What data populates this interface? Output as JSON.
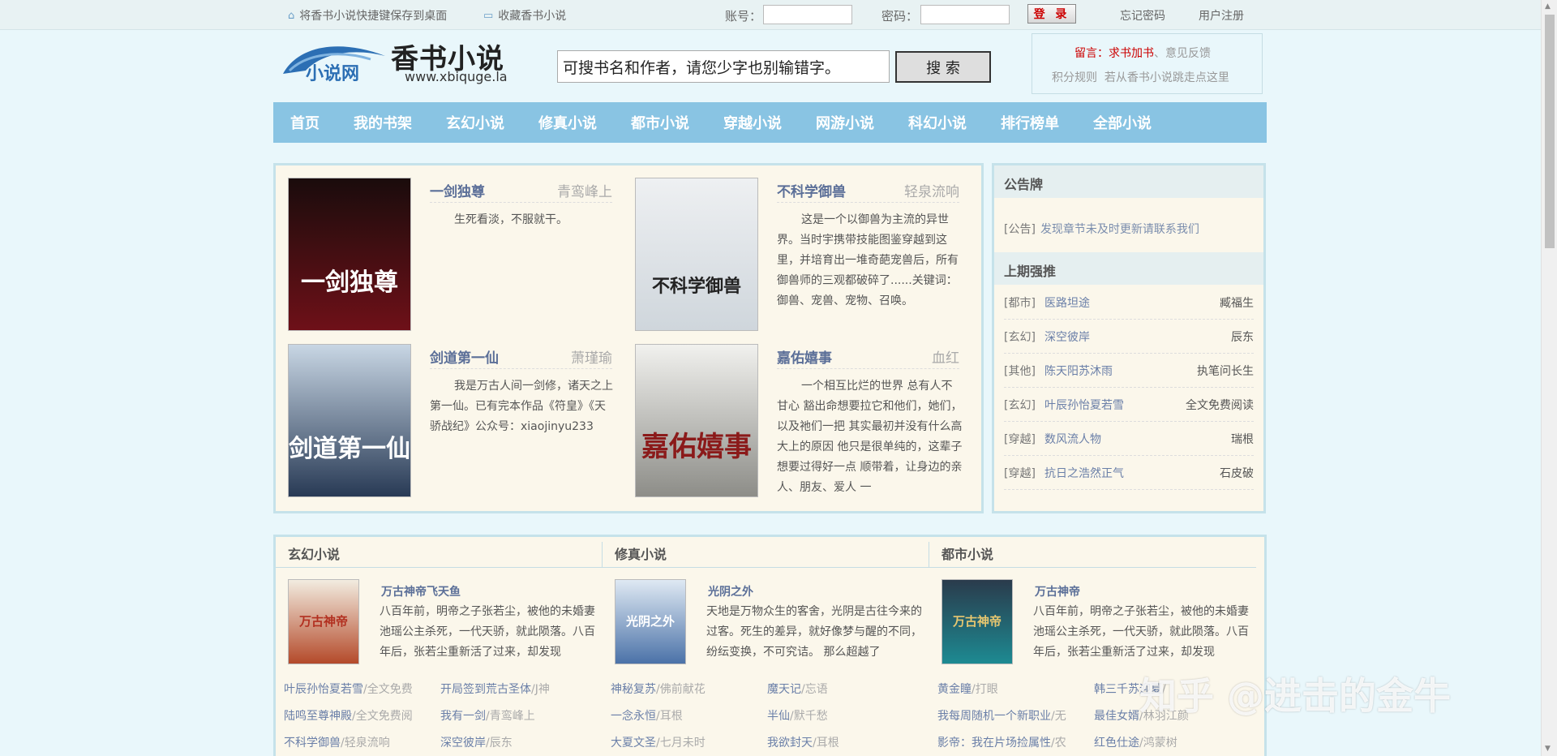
{
  "topbar": {
    "bookmark_desktop": "将香书小说快捷键保存到桌面",
    "favorite": "收藏香书小说",
    "account_label": "账号：",
    "password_label": "密码：",
    "login_label": "登 录",
    "forgot_password": "忘记密码",
    "register": "用户注册"
  },
  "header": {
    "logo_tagline": "小说网",
    "logo_brand": "香书小说",
    "logo_url": "www.xbiquge.la",
    "search_value": "可搜书名和作者，请您少字也别输错字。",
    "search_button": "搜 索",
    "note_prefix": "留言：",
    "note_add_book": "求书加书",
    "note_sep": "、",
    "note_feedback": "意见反馈",
    "note_rules": "积分规则",
    "note_slow": "若从香书小说跳走点这里"
  },
  "nav": [
    "首页",
    "我的书架",
    "玄幻小说",
    "修真小说",
    "都市小说",
    "穿越小说",
    "网游小说",
    "科幻小说",
    "排行榜单",
    "全部小说"
  ],
  "hot_books": [
    {
      "title": "一剑独尊",
      "author": "青鸾峰上",
      "desc": "生死看淡，不服就干。",
      "cover_text": "一剑独尊",
      "cover_colors": [
        "#1a0c0c",
        "#6e1018"
      ]
    },
    {
      "title": "不科学御兽",
      "author": "轻泉流响",
      "desc": "这是一个以御兽为主流的异世界。当时宇携带技能图鉴穿越到这里，并培育出一堆奇葩宠兽后，所有御兽师的三观都破碎了......关键词：御兽、宠兽、宠物、召唤。",
      "cover_text": "不科学御兽",
      "cover_colors": [
        "#eef0f2",
        "#cfd6dc"
      ]
    },
    {
      "title": "剑道第一仙",
      "author": "萧瑾瑜",
      "desc": "我是万古人间一剑修，诸天之上第一仙。已有完本作品《符皇》《天骄战纪》公众号：xiaojinyu233",
      "cover_text": "剑道第一仙",
      "cover_colors": [
        "#c8d6e4",
        "#283a55"
      ]
    },
    {
      "title": "嘉佑嬉事",
      "author": "血红",
      "desc": "一个相互比烂的世界 总有人不甘心 豁出命想要拉它和他们，她们，以及祂们一把 其实最初并没有什么高大上的原因 他只是很单纯的，这辈子想要过得好一点 顺带着，让身边的亲人、朋友、爱人 一",
      "cover_text": "嘉佑嬉事",
      "cover_colors": [
        "#f1f1ee",
        "#8d8d88"
      ]
    }
  ],
  "notice": {
    "head": "公告牌",
    "tag": "[公告]",
    "text": "发现章节未及时更新请联系我们",
    "rec_head": "上期强推",
    "recs": [
      {
        "cat": "[都市]",
        "title": "医路坦途",
        "author": "臧福生"
      },
      {
        "cat": "[玄幻]",
        "title": "深空彼岸",
        "author": "辰东"
      },
      {
        "cat": "[其他]",
        "title": "陈天阳苏沐雨",
        "author": "执笔问长生"
      },
      {
        "cat": "[玄幻]",
        "title": "叶辰孙怡夏若雪",
        "author": "全文免费阅读"
      },
      {
        "cat": "[穿越]",
        "title": "数风流人物",
        "author": "瑞根"
      },
      {
        "cat": "[穿越]",
        "title": "抗日之浩然正气",
        "author": "石皮破"
      }
    ]
  },
  "categories": [
    {
      "head": "玄幻小说",
      "featured_title": "万古神帝飞天鱼",
      "featured_desc": "八百年前，明帝之子张若尘，被他的未婚妻池瑶公主杀死，一代天骄，就此陨落。八百年后，张若尘重新活了过来，却发现",
      "thumb_text": "万古神帝",
      "thumb_colors": [
        "#f2ece0",
        "#b44a2a"
      ],
      "links": [
        [
          "叶辰孙怡夏若雪",
          "/全文免费",
          "开局签到荒古圣体",
          "/J神"
        ],
        [
          "陆鸣至尊神殿",
          "/全文免费阅",
          "我有一剑",
          "/青鸾峰上"
        ],
        [
          "不科学御兽",
          "/轻泉流响",
          "深空彼岸",
          "/辰东"
        ]
      ]
    },
    {
      "head": "修真小说",
      "featured_title": "光阴之外",
      "featured_desc": "天地是万物众生的客舍，光阴是古往今来的过客。死生的差异，就好像梦与醒的不同，纷纭变换，不可究诘。 那么超越了",
      "thumb_text": "光阴之外",
      "thumb_colors": [
        "#dfe9f3",
        "#4b72a8"
      ],
      "links": [
        [
          "神秘复苏",
          "/佛前献花",
          "魔天记",
          "/忘语"
        ],
        [
          "一念永恒",
          "/耳根",
          "半仙",
          "/默千愁"
        ],
        [
          "大夏文圣",
          "/七月未时",
          "我欲封天",
          "/耳根"
        ]
      ]
    },
    {
      "head": "都市小说",
      "featured_title": "万古神帝",
      "featured_desc": "八百年前，明帝之子张若尘，被他的未婚妻池瑶公主杀死，一代天骄，就此陨落。八百年后，张若尘重新活了过来，却发现",
      "thumb_text": "万古神帝",
      "thumb_colors": [
        "#2a3b4c",
        "#1d8a92"
      ],
      "links": [
        [
          "黄金瞳",
          "/打眼",
          "韩三千苏迎夏",
          "/"
        ],
        [
          "我每周随机一个新职业",
          "/无",
          "最佳女婿",
          "/林羽江颜"
        ],
        [
          "影帝：我在片场捡属性",
          "/农",
          "红色仕途",
          "/鸿蒙树"
        ]
      ]
    }
  ],
  "watermark": "知乎 @进击的金牛",
  "colors": {
    "nav_bg": "#89c4e3",
    "page_bg": "#e9f7fb",
    "panel_bg": "#fbf7eb",
    "link": "#6a7fa8",
    "accent_red": "#cc0000"
  }
}
